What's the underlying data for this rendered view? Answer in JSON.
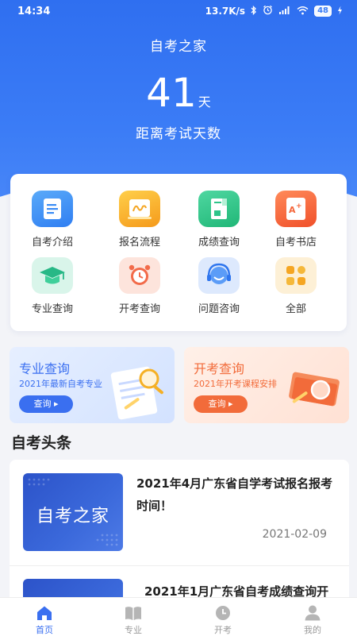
{
  "status_bar": {
    "time": "14:34",
    "speed": "13.7K/s",
    "battery": "48"
  },
  "header": {
    "title": "自考之家",
    "countdown_number": "41",
    "countdown_unit": "天",
    "countdown_label": "距离考试天数"
  },
  "grid": {
    "items": [
      {
        "label": "自考介绍",
        "icon": "document-icon",
        "color": "#3a8cf5"
      },
      {
        "label": "报名流程",
        "icon": "flow-icon",
        "color": "#f5a623"
      },
      {
        "label": "成绩查询",
        "icon": "score-icon",
        "color": "#2ec48a"
      },
      {
        "label": "自考书店",
        "icon": "book-store-icon",
        "color": "#f5663a"
      },
      {
        "label": "专业查询",
        "icon": "graduation-cap-icon",
        "color": "#2bbf8e"
      },
      {
        "label": "开考查询",
        "icon": "alarm-clock-icon",
        "color": "#f26b4a"
      },
      {
        "label": "问题咨询",
        "icon": "headset-icon",
        "color": "#3a8cf5"
      },
      {
        "label": "全部",
        "icon": "apps-icon",
        "color": "#f5b025"
      }
    ]
  },
  "banners": [
    {
      "title": "专业查询",
      "subtitle": "2021年最新自考专业",
      "button": "查询",
      "accent": "#3a6ff0"
    },
    {
      "title": "开考查询",
      "subtitle": "2021年开考课程安排",
      "button": "查询",
      "accent": "#f26b3a"
    }
  ],
  "news_section": {
    "title": "自考头条",
    "items": [
      {
        "thumb_text": "自考之家",
        "title": "2021年4月广东省自学考试报名报考时间！",
        "date": "2021-02-09"
      },
      {
        "thumb_text": "",
        "title": "2021年1月广东省自考成绩查询开",
        "date": ""
      }
    ]
  },
  "tabbar": {
    "tabs": [
      {
        "label": "首页",
        "icon": "home-icon",
        "active": true
      },
      {
        "label": "专业",
        "icon": "open-book-icon",
        "active": false
      },
      {
        "label": "开考",
        "icon": "clock-icon",
        "active": false
      },
      {
        "label": "我的",
        "icon": "user-icon",
        "active": false
      }
    ]
  },
  "colors": {
    "primary": "#3a6ff0",
    "orange": "#f26b3a"
  }
}
